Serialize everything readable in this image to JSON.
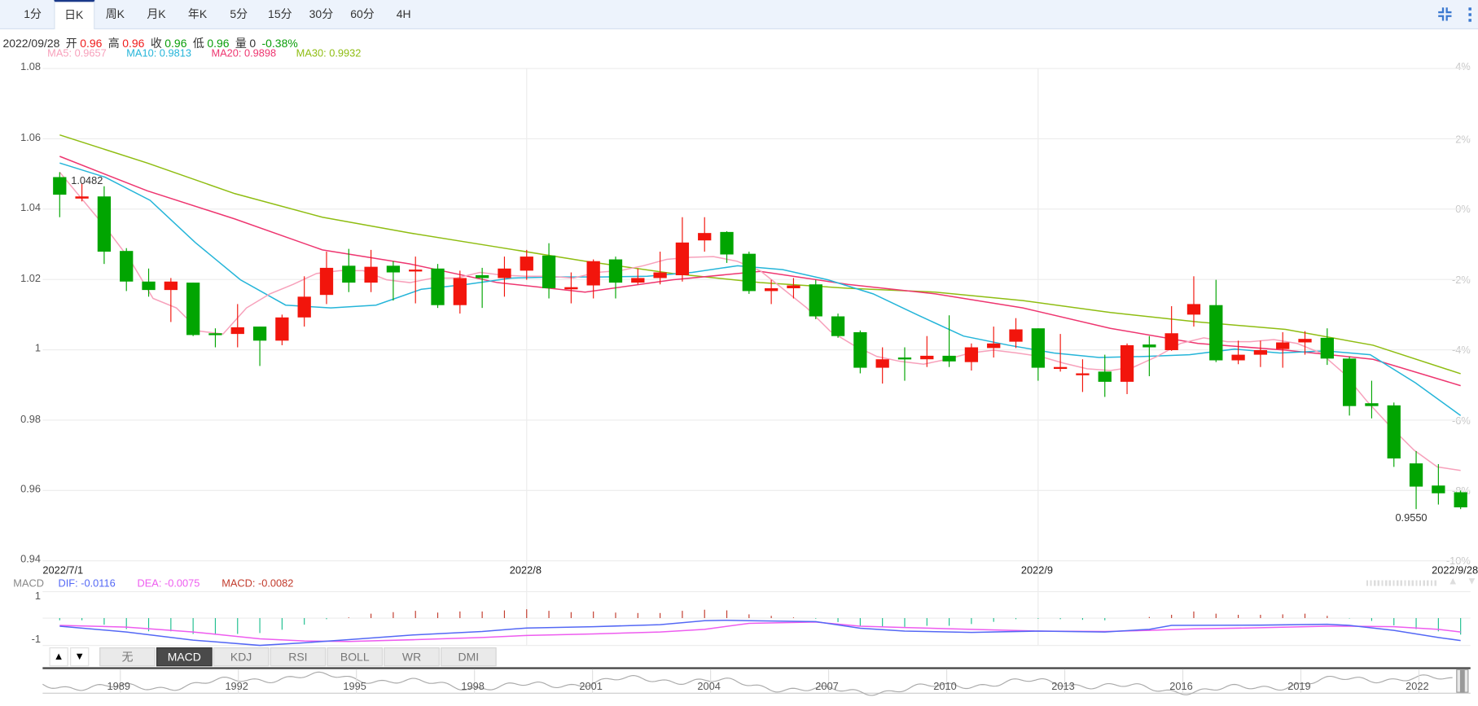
{
  "toolbar": {
    "tabs": [
      "1分",
      "日K",
      "周K",
      "月K",
      "年K",
      "5分",
      "15分",
      "30分",
      "60分",
      "4H"
    ],
    "active_tab": "日K",
    "icons": [
      "compress-icon",
      "more-vertical-icon"
    ]
  },
  "info": {
    "date": "2022/09/28",
    "open_label": "开",
    "open": "0.96",
    "high_label": "高",
    "high": "0.96",
    "close_label": "收",
    "close": "0.96",
    "low_label": "低",
    "low": "0.96",
    "volume_label": "量",
    "volume": "0",
    "change": "-0.38%"
  },
  "ma_legend": {
    "ma5": "MA5: 0.9657",
    "ma10": "MA10: 0.9813",
    "ma20": "MA20: 0.9898",
    "ma30": "MA30: 0.9932"
  },
  "colors": {
    "up": "#f2150c",
    "down": "#01a501",
    "ma5": "#f7a1bb",
    "ma10": "#25b5d9",
    "ma20": "#ee3670",
    "ma30": "#8fbd12",
    "dif": "#5468f5",
    "dea": "#ee5cef",
    "macd": "#c23b2c"
  },
  "chart_data": [
    {
      "type": "candlestick",
      "title": "",
      "y_ticks": [
        "1.08",
        "1.06",
        "1.04",
        "1.02",
        "1",
        "0.98",
        "0.96",
        "0.94"
      ],
      "ylim": [
        0.94,
        1.08
      ],
      "pct_ticks": [
        "4%",
        "2%",
        "0%",
        "-2%",
        "-4%",
        "-6%",
        "-8%",
        "-10%"
      ],
      "x_labels": [
        {
          "idx": 0,
          "text": "2022/7/1"
        },
        {
          "idx": 21,
          "text": "2022/8"
        },
        {
          "idx": 44,
          "text": "2022/9"
        },
        {
          "idx": 63,
          "text": "2022/9/28"
        }
      ],
      "annotations": {
        "max_label": "1.0482",
        "min_label": "0.9550"
      },
      "ohlc": [
        [
          1.0491,
          1.0505,
          1.0377,
          1.0441
        ],
        [
          1.043,
          1.0473,
          1.0422,
          1.0436
        ],
        [
          1.0436,
          1.0465,
          1.0244,
          1.0279
        ],
        [
          1.0281,
          1.0289,
          1.0167,
          1.0194
        ],
        [
          1.0194,
          1.0231,
          1.0151,
          1.017
        ],
        [
          1.017,
          1.0204,
          1.0079,
          1.0194
        ],
        [
          1.0191,
          1.0191,
          1.0039,
          1.0042
        ],
        [
          1.0047,
          1.0061,
          1.0007,
          1.0045
        ],
        [
          1.0045,
          1.013,
          1.0007,
          1.0064
        ],
        [
          1.0066,
          1.0066,
          0.9954,
          1.0026
        ],
        [
          1.0026,
          1.01,
          1.0013,
          1.0092
        ],
        [
          1.0092,
          1.0209,
          1.0066,
          1.0151
        ],
        [
          1.0156,
          1.0279,
          1.013,
          1.0233
        ],
        [
          1.0239,
          1.0287,
          1.0164,
          1.0191
        ],
        [
          1.0191,
          1.0284,
          1.0164,
          1.0236
        ],
        [
          1.0239,
          1.0252,
          1.014,
          1.022
        ],
        [
          1.0223,
          1.0265,
          1.0132,
          1.0228
        ],
        [
          1.0231,
          1.0244,
          1.0119,
          1.0127
        ],
        [
          1.0127,
          1.0225,
          1.0103,
          1.0204
        ],
        [
          1.0212,
          1.0233,
          1.0119,
          1.0204
        ],
        [
          1.0204,
          1.0265,
          1.0151,
          1.0231
        ],
        [
          1.0225,
          1.0284,
          1.0199,
          1.0265
        ],
        [
          1.0268,
          1.0303,
          1.0146,
          1.0175
        ],
        [
          1.0172,
          1.022,
          1.0132,
          1.0178
        ],
        [
          1.0183,
          1.0257,
          1.0146,
          1.0252
        ],
        [
          1.0257,
          1.0265,
          1.0146,
          1.0191
        ],
        [
          1.0191,
          1.0231,
          1.0186,
          1.0204
        ],
        [
          1.0204,
          1.0279,
          1.0186,
          1.022
        ],
        [
          1.0212,
          1.0377,
          1.0194,
          1.0305
        ],
        [
          1.0311,
          1.0377,
          1.0279,
          1.0332
        ],
        [
          1.0335,
          1.0337,
          1.0247,
          1.0271
        ],
        [
          1.0273,
          1.0279,
          1.0159,
          1.0167
        ],
        [
          1.0167,
          1.0199,
          1.013,
          1.0175
        ],
        [
          1.0175,
          1.0204,
          1.0146,
          1.0183
        ],
        [
          1.0186,
          1.0199,
          1.0087,
          1.0095
        ],
        [
          1.0095,
          1.0103,
          1.0034,
          1.0039
        ],
        [
          1.005,
          1.0055,
          0.9933,
          0.9949
        ],
        [
          0.9949,
          1.0007,
          0.9904,
          0.9973
        ],
        [
          0.9978,
          1.0007,
          0.9912,
          0.9973
        ],
        [
          0.9973,
          1.0039,
          0.9951,
          0.9983
        ],
        [
          0.9983,
          1.0098,
          0.9951,
          0.9967
        ],
        [
          0.9965,
          1.0018,
          0.9941,
          1.0007
        ],
        [
          1.0005,
          1.0066,
          0.9978,
          1.0018
        ],
        [
          1.0023,
          1.009,
          1.0005,
          1.0058
        ],
        [
          1.0061,
          1.0061,
          0.9912,
          0.9949
        ],
        [
          0.9946,
          1.0045,
          0.9938,
          0.9951
        ],
        [
          0.9928,
          0.9973,
          0.988,
          0.9933
        ],
        [
          0.9938,
          0.9986,
          0.9866,
          0.9909
        ],
        [
          0.9909,
          1.0018,
          0.9874,
          1.0013
        ],
        [
          1.0015,
          1.0039,
          0.9925,
          1.0007
        ],
        [
          0.9999,
          1.0124,
          0.9997,
          1.0047
        ],
        [
          1.01,
          1.0209,
          1.0066,
          1.013
        ],
        [
          1.0127,
          1.0199,
          0.9965,
          0.997
        ],
        [
          0.997,
          1.0026,
          0.9959,
          0.9986
        ],
        [
          0.9986,
          1.0026,
          0.9951,
          0.9999
        ],
        [
          1.0002,
          1.005,
          0.9949,
          1.0021
        ],
        [
          1.0021,
          1.0053,
          0.9986,
          1.0031
        ],
        [
          1.0034,
          1.0061,
          0.9957,
          0.9975
        ],
        [
          0.9975,
          0.9981,
          0.9813,
          0.984
        ],
        [
          0.9848,
          0.9912,
          0.9805,
          0.984
        ],
        [
          0.9842,
          0.985,
          0.9667,
          0.9691
        ],
        [
          0.9677,
          0.9712,
          0.9547,
          0.9611
        ],
        [
          0.9614,
          0.9675,
          0.956,
          0.9592
        ],
        [
          0.9595,
          0.96,
          0.9547,
          0.9552
        ]
      ],
      "series": [
        {
          "name": "MA5",
          "values": [
            1.0505,
            1.0425,
            1.0345,
            1.0257,
            1.0146,
            1.0119,
            1.0053,
            1.0045,
            1.0119,
            1.0159,
            1.0186,
            1.0217,
            1.0225,
            1.0225,
            1.0199,
            1.0191,
            1.0204,
            1.0204,
            1.022,
            1.0212,
            1.0209,
            1.0209,
            1.0204,
            1.022,
            1.0225,
            1.0239,
            1.0257,
            1.0263,
            1.0265,
            1.0252,
            1.0225,
            1.0172,
            1.0119,
            1.0053,
            1.0013,
            0.9981,
            0.9967,
            0.9959,
            0.9973,
            0.9991,
            0.9999,
            0.9991,
            0.9981,
            0.9962,
            0.9946,
            0.9941,
            0.9951,
            0.9981,
            1.0018,
            1.0034,
            1.0023,
            1.0023,
            1.0029,
            1.0018,
            0.9991,
            0.9933,
            0.9853,
            0.9781,
            0.9715,
            0.9667,
            0.9657
          ]
        },
        {
          "name": "MA10",
          "values": [
            1.0531,
            1.0491,
            1.0425,
            1.0305,
            1.0199,
            1.0127,
            1.0119,
            1.0127,
            1.0172,
            1.0186,
            1.0204,
            1.0207,
            1.0207,
            1.0209,
            1.022,
            1.0239,
            1.0228,
            1.0199,
            1.0159,
            1.0098,
            1.0039,
            1.0013,
            0.9991,
            0.9978,
            0.9981,
            0.9986,
            1.0002,
            0.9991,
            0.9997,
            0.9986,
            0.9906,
            0.9813
          ]
        },
        {
          "name": "MA20",
          "values": [
            1.055,
            1.0452,
            1.0372,
            1.0284,
            1.0244,
            1.0191,
            1.0164,
            1.0199,
            1.0223,
            1.0186,
            1.0159,
            1.0119,
            1.0061,
            1.0018,
            0.9999,
            0.9973,
            0.9898
          ]
        },
        {
          "name": "MA30",
          "values": [
            1.0611,
            1.0531,
            1.0444,
            1.0377,
            1.0332,
            1.0292,
            1.0252,
            1.0217,
            1.0191,
            1.0175,
            1.0164,
            1.014,
            1.0106,
            1.0079,
            1.0058,
            1.0013,
            0.9932
          ]
        }
      ]
    },
    {
      "type": "bar+line",
      "title": "MACD",
      "legend": {
        "label": "MACD",
        "dif": "DIF: -0.0116",
        "dea": "DEA: -0.0075",
        "macd": "MACD: -0.0082"
      },
      "y_ticks": [
        "1",
        "-1"
      ],
      "ylim": [
        -1,
        1
      ],
      "histogram": [
        -0.1,
        -0.1,
        -0.3,
        -0.5,
        -0.6,
        -0.6,
        -0.72,
        -0.76,
        -0.72,
        -0.68,
        -0.53,
        -0.3,
        -0.05,
        0.03,
        0.2,
        0.27,
        0.33,
        0.25,
        0.3,
        0.3,
        0.35,
        0.4,
        0.33,
        0.27,
        0.3,
        0.25,
        0.23,
        0.23,
        0.33,
        0.38,
        0.35,
        0.17,
        0.1,
        0.03,
        -0.03,
        -0.18,
        -0.35,
        -0.42,
        -0.4,
        -0.35,
        -0.35,
        -0.27,
        -0.17,
        -0.05,
        -0.03,
        -0.05,
        -0.08,
        -0.1,
        0,
        0.05,
        0.15,
        0.3,
        0.2,
        0.15,
        0.15,
        0.17,
        0.2,
        0.1,
        -0.02,
        -0.13,
        -0.33,
        -0.5,
        -0.6,
        -0.75
      ],
      "dif": [
        [
          0,
          -0.37
        ],
        [
          3,
          -0.63
        ],
        [
          6,
          -1.0
        ],
        [
          9,
          -1.24
        ],
        [
          11,
          -1.12
        ],
        [
          13,
          -0.98
        ],
        [
          16,
          -0.76
        ],
        [
          19,
          -0.61
        ],
        [
          21,
          -0.45
        ],
        [
          24,
          -0.39
        ],
        [
          27,
          -0.3
        ],
        [
          29,
          -0.12
        ],
        [
          30,
          -0.1
        ],
        [
          31,
          -0.12
        ],
        [
          34,
          -0.16
        ],
        [
          36,
          -0.46
        ],
        [
          38,
          -0.59
        ],
        [
          41,
          -0.65
        ],
        [
          44,
          -0.59
        ],
        [
          47,
          -0.63
        ],
        [
          49,
          -0.51
        ],
        [
          50,
          -0.33
        ],
        [
          54,
          -0.32
        ],
        [
          57,
          -0.28
        ],
        [
          58,
          -0.33
        ],
        [
          60,
          -0.56
        ],
        [
          62,
          -0.88
        ],
        [
          63,
          -1.02
        ]
      ],
      "dea": [
        [
          0,
          -0.33
        ],
        [
          3,
          -0.41
        ],
        [
          6,
          -0.63
        ],
        [
          9,
          -0.94
        ],
        [
          11,
          -1.04
        ],
        [
          13,
          -1.06
        ],
        [
          16,
          -0.98
        ],
        [
          19,
          -0.88
        ],
        [
          21,
          -0.79
        ],
        [
          24,
          -0.72
        ],
        [
          27,
          -0.63
        ],
        [
          29,
          -0.51
        ],
        [
          31,
          -0.24
        ],
        [
          34,
          -0.18
        ],
        [
          36,
          -0.37
        ],
        [
          38,
          -0.43
        ],
        [
          41,
          -0.51
        ],
        [
          44,
          -0.59
        ],
        [
          47,
          -0.61
        ],
        [
          49,
          -0.56
        ],
        [
          51,
          -0.49
        ],
        [
          54,
          -0.44
        ],
        [
          57,
          -0.37
        ],
        [
          58,
          -0.37
        ],
        [
          60,
          -0.39
        ],
        [
          62,
          -0.51
        ],
        [
          63,
          -0.63
        ]
      ]
    }
  ],
  "indicator_tabs": {
    "up_arrow": "▲",
    "down_arrow": "▼",
    "tabs": [
      "无",
      "MACD",
      "KDJ",
      "RSI",
      "BOLL",
      "WR",
      "DMI"
    ],
    "active": "MACD"
  },
  "navigator": {
    "years": [
      "1989",
      "1992",
      "1995",
      "1998",
      "2001",
      "2004",
      "2007",
      "2010",
      "2013",
      "2016",
      "2019",
      "2022"
    ]
  }
}
